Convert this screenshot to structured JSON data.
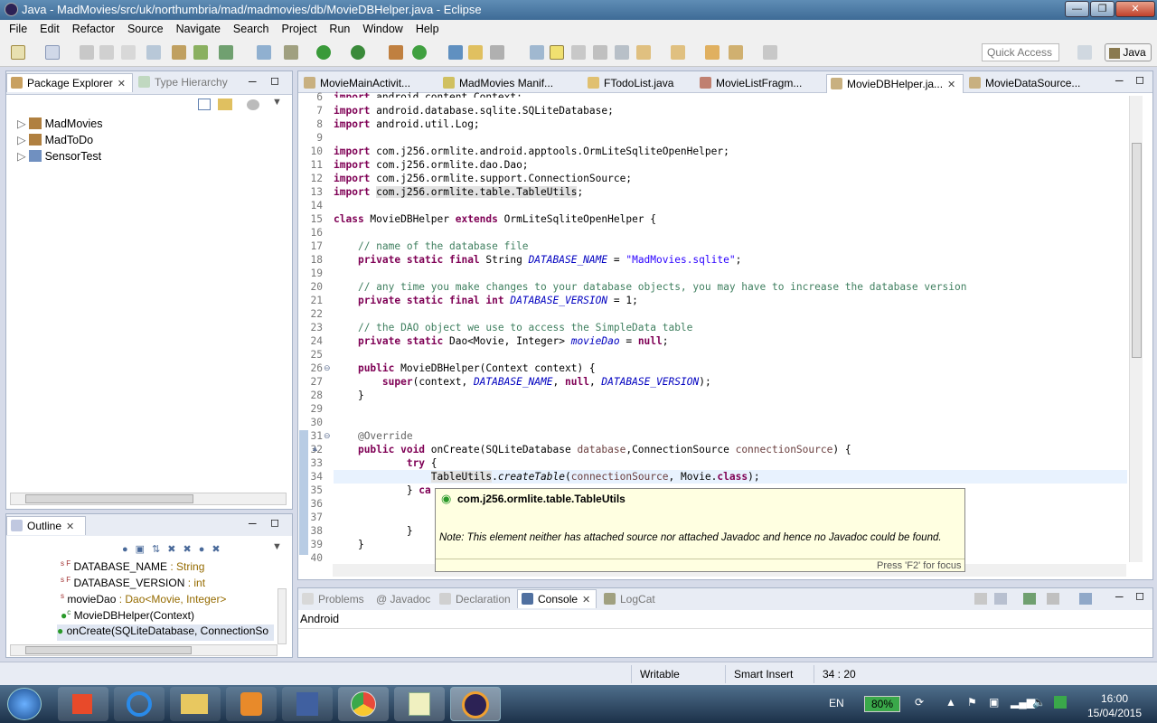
{
  "window": {
    "title": "Java - MadMovies/src/uk/northumbria/mad/madmovies/db/MovieDBHelper.java - Eclipse"
  },
  "menu": [
    "File",
    "Edit",
    "Refactor",
    "Source",
    "Navigate",
    "Search",
    "Project",
    "Run",
    "Window",
    "Help"
  ],
  "toolbar": {
    "quick_access": "Quick Access",
    "perspective": "Java"
  },
  "left_panel": {
    "tabs": [
      {
        "label": "Package Explorer",
        "active": true
      },
      {
        "label": "Type Hierarchy",
        "active": false
      }
    ],
    "projects": [
      "MadMovies",
      "MadToDo",
      "SensorTest"
    ]
  },
  "outline": {
    "tab": "Outline",
    "items": [
      {
        "marker": "s F",
        "name": "DATABASE_NAME",
        "type": " : String"
      },
      {
        "marker": "s F",
        "name": "DATABASE_VERSION",
        "type": " : int"
      },
      {
        "marker": "s",
        "name": "movieDao",
        "type": " : Dao<Movie, Integer>"
      },
      {
        "marker": "c",
        "name": "MovieDBHelper(Context)",
        "type": ""
      },
      {
        "marker": "",
        "name": "onCreate(SQLiteDatabase, ConnectionSo",
        "type": ""
      }
    ]
  },
  "editor": {
    "tabs": [
      {
        "label": "MovieMainActivit...",
        "active": false
      },
      {
        "label": "MadMovies Manif...",
        "active": false
      },
      {
        "label": "FTodoList.java",
        "active": false
      },
      {
        "label": "MovieListFragm...",
        "active": false
      },
      {
        "label": "MovieDBHelper.ja...",
        "active": true
      },
      {
        "label": "MovieDataSource...",
        "active": false
      }
    ],
    "line_numbers": [
      "6",
      "7",
      "8",
      "9",
      "10",
      "11",
      "12",
      "13",
      "14",
      "15",
      "16",
      "17",
      "18",
      "19",
      "20",
      "21",
      "22",
      "23",
      "24",
      "25",
      "26",
      "27",
      "28",
      "29",
      "30",
      "31",
      "32",
      "33",
      "34",
      "35",
      "36",
      "37",
      "38",
      "39",
      "40"
    ]
  },
  "hover": {
    "title": "com.j256.ormlite.table.TableUtils",
    "note": "Note: This element neither has attached source nor attached Javadoc and hence no Javadoc could be found.",
    "footer": "Press 'F2' for focus"
  },
  "bottom_panel": {
    "tabs": [
      {
        "label": "Problems",
        "active": false
      },
      {
        "label": "@ Javadoc",
        "active": false
      },
      {
        "label": "Declaration",
        "active": false
      },
      {
        "label": "Console",
        "active": true
      },
      {
        "label": "LogCat",
        "active": false
      }
    ],
    "console_header": "Android"
  },
  "status": {
    "writable": "Writable",
    "insert_mode": "Smart Insert",
    "position": "34 : 20"
  },
  "taskbar": {
    "language": "EN",
    "battery": "80%",
    "time": "16:00",
    "date": "15/04/2015"
  }
}
